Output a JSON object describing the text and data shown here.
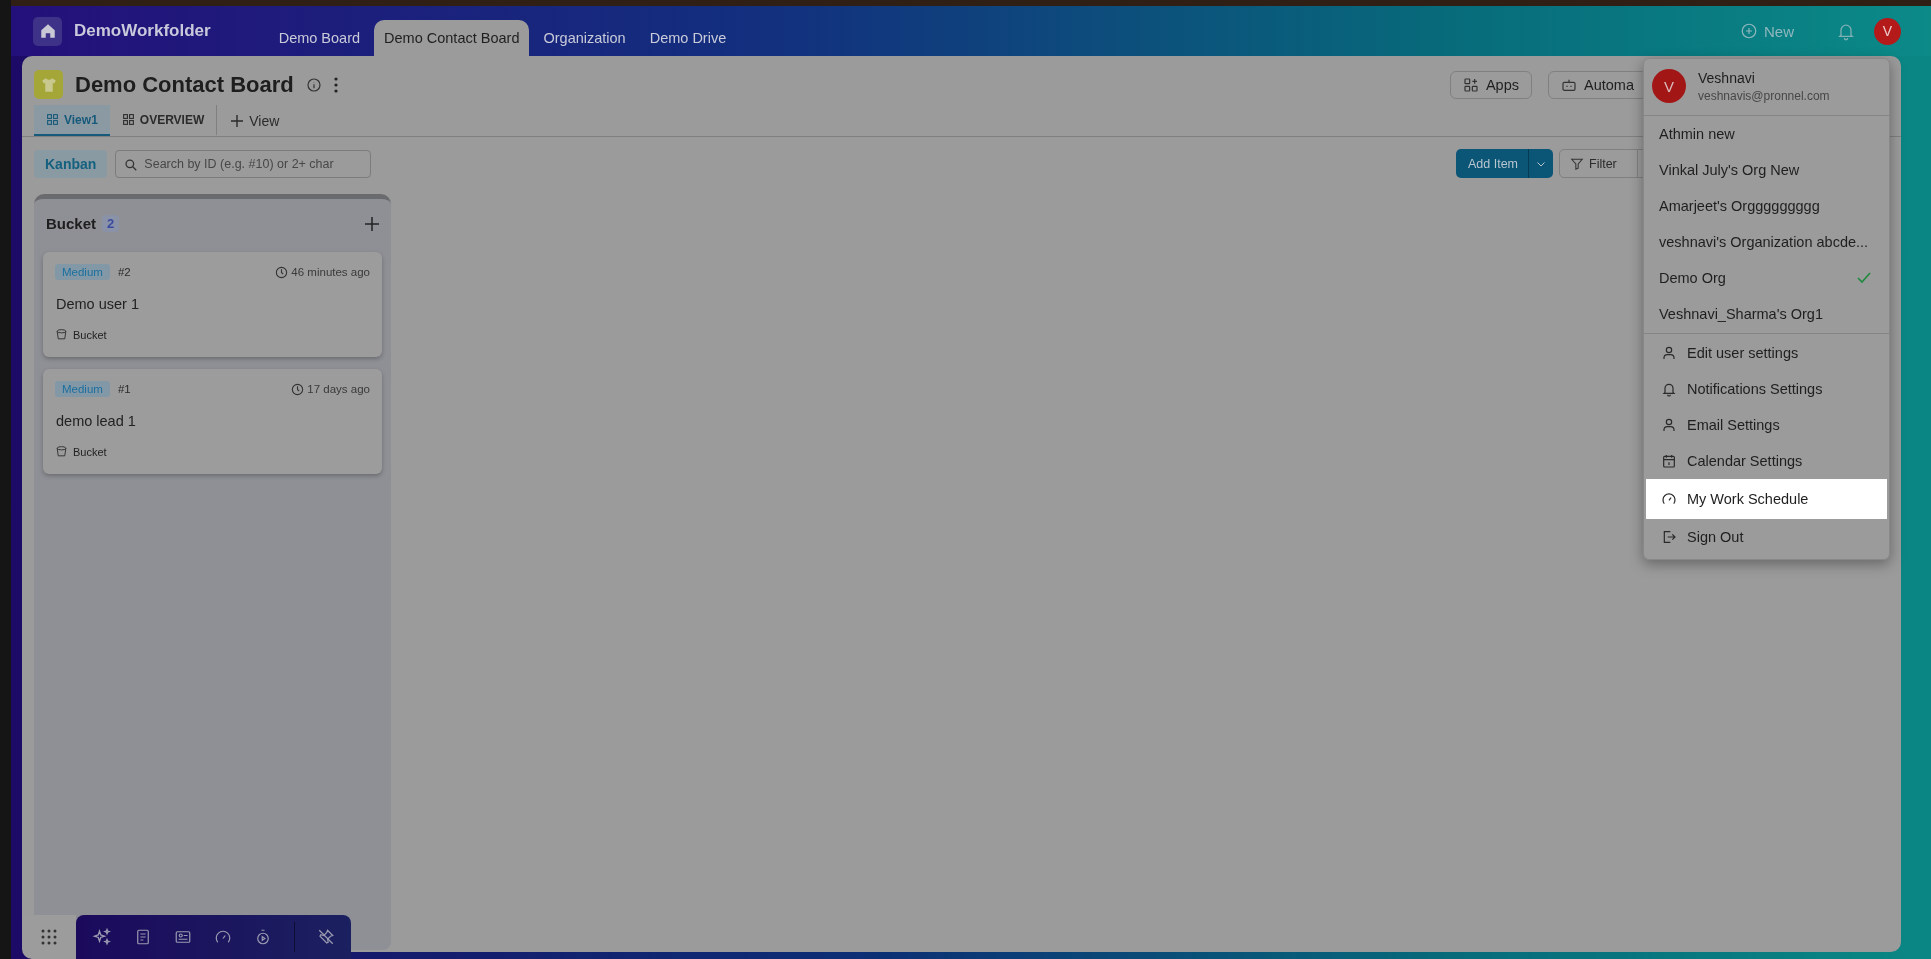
{
  "top_bar": {
    "app_name": "DemoWorkfolder",
    "new_label": "New",
    "avatar_letter": "V",
    "tabs": [
      {
        "label": "Demo Board",
        "selected": false
      },
      {
        "label": "Demo Contact Board",
        "selected": true
      },
      {
        "label": "Organization",
        "selected": false
      },
      {
        "label": "Demo Drive",
        "selected": false
      }
    ]
  },
  "board": {
    "title": "Demo Contact Board",
    "actions": [
      "Apps",
      "Automa"
    ],
    "views": [
      {
        "label": "View1",
        "selected": true
      },
      {
        "label": "OVERVIEW",
        "selected": false
      }
    ],
    "add_view": "View",
    "layout_label": "Kanban",
    "search_placeholder": "Search by ID (e.g. #10) or 2+ char",
    "add_item": "Add Item",
    "filter": "Filter"
  },
  "columns": [
    {
      "title": "Bucket",
      "count": "2",
      "cards": [
        {
          "priority": "Medium",
          "id": "#2",
          "time": "46 minutes ago",
          "title": "Demo user 1",
          "group": "Bucket"
        },
        {
          "priority": "Medium",
          "id": "#1",
          "time": "17 days ago",
          "title": "demo lead 1",
          "group": "Bucket"
        }
      ]
    }
  ],
  "user_menu": {
    "name": "Veshnavi",
    "email": "veshnavis@pronnel.com",
    "avatar_letter": "V",
    "orgs": [
      {
        "label": "Athmin new",
        "selected": false
      },
      {
        "label": "Vinkal July's Org New",
        "selected": false
      },
      {
        "label": "Amarjeet's Orggggggggg",
        "selected": false
      },
      {
        "label": "veshnavi's Organization abcde...",
        "selected": false
      },
      {
        "label": "Demo Org",
        "selected": true
      },
      {
        "label": "Veshnavi_Sharma's Org1",
        "selected": false
      }
    ],
    "items": [
      {
        "label": "Edit user settings",
        "kind": "person",
        "highlighted": false
      },
      {
        "label": "Notifications Settings",
        "kind": "bell",
        "highlighted": false
      },
      {
        "label": "Email Settings",
        "kind": "person",
        "highlighted": false
      },
      {
        "label": "Calendar Settings",
        "kind": "calendar",
        "highlighted": false
      },
      {
        "label": "My Work Schedule",
        "kind": "gauge",
        "highlighted": true
      },
      {
        "label": "Sign Out",
        "kind": "signout",
        "highlighted": false
      }
    ]
  }
}
